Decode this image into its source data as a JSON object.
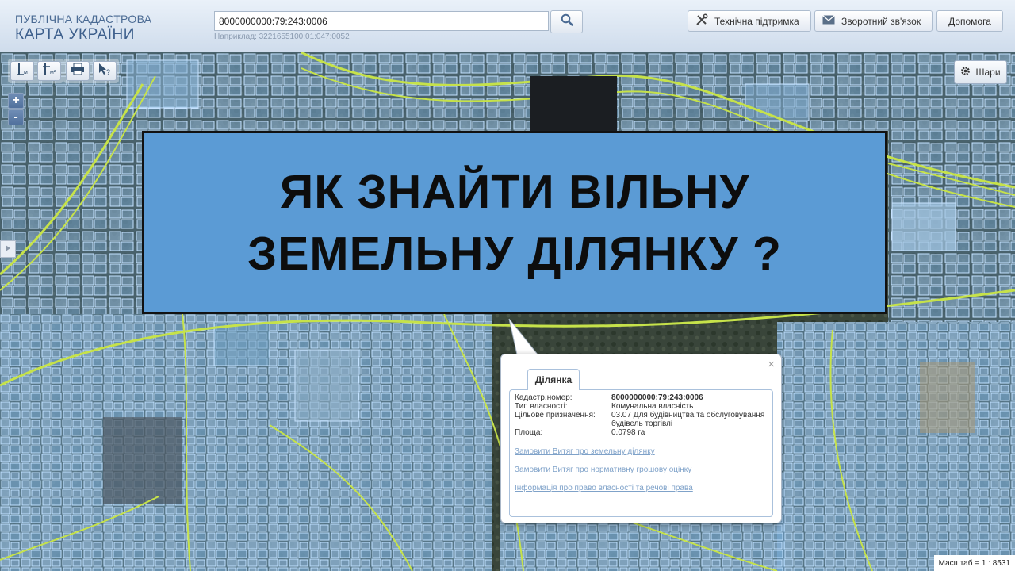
{
  "header": {
    "logo_line1": "ПУБЛІЧНА КАДАСТРОВА",
    "logo_line2": "КАРТА УКРАЇНИ",
    "search_value": "8000000000:79:243:0006",
    "search_hint": "Наприклад: 3221655100:01:047:0052",
    "buttons": {
      "support": "Технічна підтримка",
      "feedback": "Зворотний зв'язок",
      "help": "Допомога"
    }
  },
  "map_tools": {
    "layers_label": "Шари",
    "zoom_in": "+",
    "zoom_out": "-"
  },
  "banner": {
    "line1": "ЯК ЗНАЙТИ ВІЛЬНУ",
    "line2": "ЗЕМЕЛЬНУ ДІЛЯНКУ ?"
  },
  "popup": {
    "tab_label": "Ділянка",
    "close": "×",
    "rows": [
      {
        "label": "Кадастр.номер:",
        "value": "8000000000:79:243:0006"
      },
      {
        "label": "Тип власності:",
        "value": "Комунальна власність"
      },
      {
        "label": "Цільове призначення:",
        "value": "03.07 Для будівництва та обслуговування будівель торгівлі"
      },
      {
        "label": "Площа:",
        "value": "0.0798 га"
      }
    ],
    "links": [
      "Замовити Витяг про земельну ділянку",
      "Замовити Витяг про нормативну грошову оцінку",
      "Інформація про право власності та речові права"
    ]
  },
  "scale": "Масштаб = 1 : 8531",
  "colors": {
    "banner_bg": "#5b9bd5",
    "parcel_fill": "#7fb7e6",
    "road_line": "#c6e24a",
    "header_text": "#3d5f8c"
  }
}
